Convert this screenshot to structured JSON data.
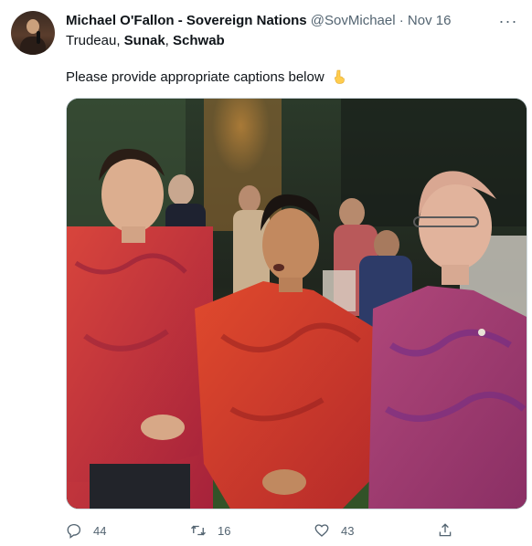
{
  "tweet": {
    "author_name": "Michael O'Fallon - Sovereign Nations",
    "author_handle": "@SovMichael",
    "separator": "·",
    "date": "Nov 16",
    "replying_parts": [
      {
        "text": "Trudeau, ",
        "bold": false
      },
      {
        "text": "Sunak",
        "bold": true
      },
      {
        "text": ", ",
        "bold": false
      },
      {
        "text": "Schwab",
        "bold": true
      }
    ],
    "text": "Please provide appropriate captions below",
    "emoji": "pointing-down-hand-icon",
    "more_label": "···"
  },
  "actions": {
    "reply_count": "44",
    "retweet_count": "16",
    "like_count": "43"
  },
  "colors": {
    "text": "#0f1419",
    "secondary": "#536471",
    "border": "#cfd9de"
  }
}
